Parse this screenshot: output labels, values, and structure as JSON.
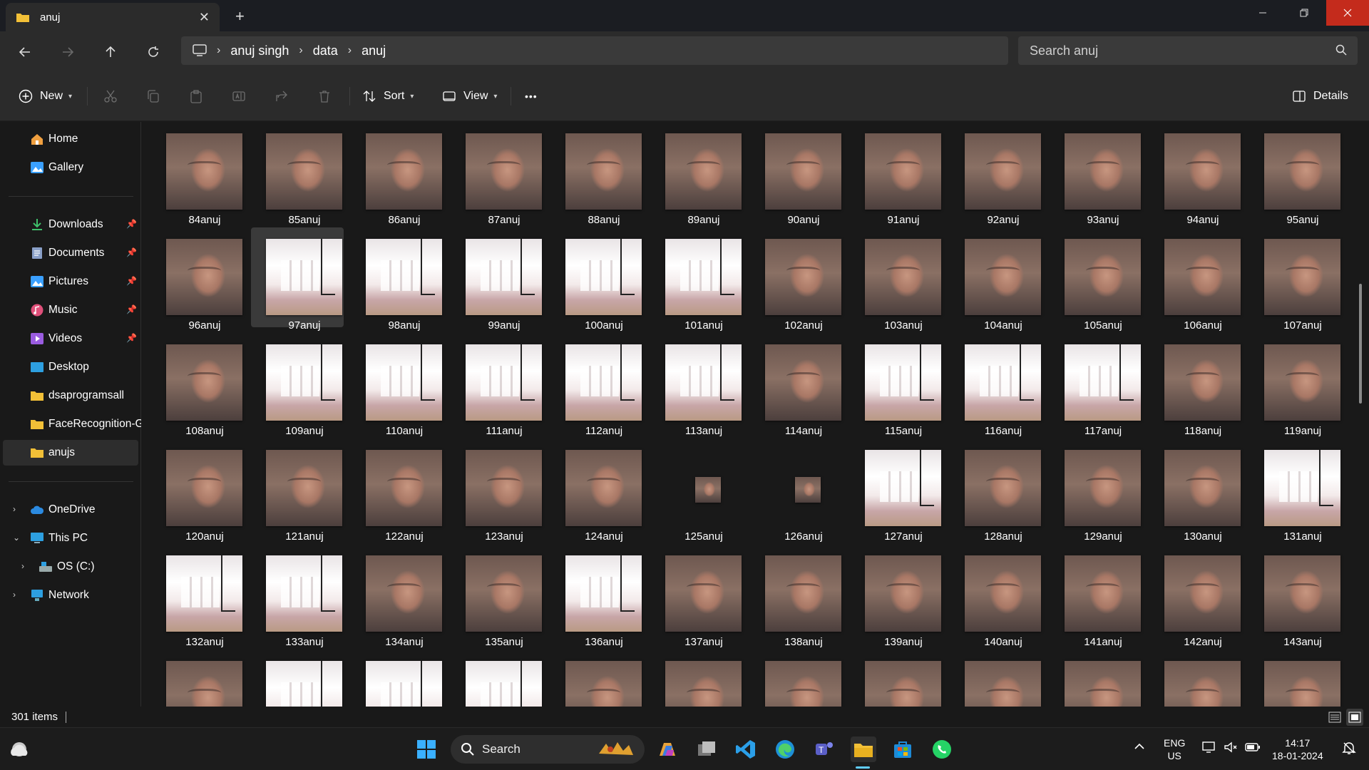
{
  "window": {
    "tab_title": "anuj",
    "close_tab_glyph": "✕",
    "new_tab_glyph": "+"
  },
  "address": {
    "crumbs": [
      "anuj singh",
      "data",
      "anuj"
    ],
    "search_placeholder": "Search anuj"
  },
  "toolbar": {
    "new_label": "New",
    "sort_label": "Sort",
    "view_label": "View",
    "more_label": "•••",
    "details_label": "Details"
  },
  "sidebar": {
    "items": [
      {
        "label": "Home",
        "icon": "home-icon",
        "color": "#f0a040"
      },
      {
        "label": "Gallery",
        "icon": "gallery-icon",
        "color": "#3aa0ff"
      },
      {
        "label": "Downloads",
        "icon": "download-icon",
        "color": "#3fc06a",
        "pinned": true
      },
      {
        "label": "Documents",
        "icon": "document-icon",
        "color": "#8aa0c8",
        "pinned": true
      },
      {
        "label": "Pictures",
        "icon": "picture-icon",
        "color": "#3aa0ff",
        "pinned": true
      },
      {
        "label": "Music",
        "icon": "music-icon",
        "color": "#e0507a",
        "pinned": true
      },
      {
        "label": "Videos",
        "icon": "video-icon",
        "color": "#9a5ce0",
        "pinned": true
      },
      {
        "label": "Desktop",
        "icon": "desktop-icon",
        "color": "#2d9fe0"
      },
      {
        "label": "dsaprogramsall",
        "icon": "folder-icon",
        "color": "#f2c037"
      },
      {
        "label": "FaceRecognition-GUI",
        "icon": "folder-icon",
        "color": "#f2c037"
      },
      {
        "label": "anujs",
        "icon": "folder-icon",
        "color": "#f2c037"
      }
    ],
    "tree": [
      {
        "label": "OneDrive",
        "icon": "cloud-icon"
      },
      {
        "label": "This PC",
        "icon": "pc-icon"
      },
      {
        "label": "OS (C:)",
        "icon": "drive-icon"
      },
      {
        "label": "Network",
        "icon": "network-icon"
      }
    ]
  },
  "files": {
    "rows": [
      [
        "84anuj",
        "85anuj",
        "86anuj",
        "87anuj",
        "88anuj",
        "89anuj",
        "90anuj",
        "91anuj",
        "92anuj",
        "93anuj",
        "94anuj",
        "95anuj"
      ],
      [
        "96anuj",
        "97anuj",
        "98anuj",
        "99anuj",
        "100anuj",
        "101anuj",
        "102anuj",
        "103anuj",
        "104anuj",
        "105anuj",
        "106anuj",
        "107anuj"
      ],
      [
        "108anuj",
        "109anuj",
        "110anuj",
        "111anuj",
        "112anuj",
        "113anuj",
        "114anuj",
        "115anuj",
        "116anuj",
        "117anuj",
        "118anuj",
        "119anuj"
      ],
      [
        "120anuj",
        "121anuj",
        "122anuj",
        "123anuj",
        "124anuj",
        "125anuj",
        "126anuj",
        "127anuj",
        "128anuj",
        "129anuj",
        "130anuj",
        "131anuj"
      ],
      [
        "132anuj",
        "133anuj",
        "134anuj",
        "135anuj",
        "136anuj",
        "137anuj",
        "138anuj",
        "139anuj",
        "140anuj",
        "141anuj",
        "142anuj",
        "143anuj"
      ],
      [
        "",
        "",
        "",
        "",
        "",
        "",
        "",
        "",
        "",
        "",
        "",
        ""
      ]
    ],
    "kinds": [
      [
        "face",
        "face",
        "face",
        "face",
        "face",
        "face",
        "face",
        "face",
        "face",
        "face",
        "face",
        "face"
      ],
      [
        "face",
        "room",
        "room",
        "room",
        "room",
        "room",
        "face",
        "face",
        "face",
        "face",
        "face",
        "face"
      ],
      [
        "face",
        "room",
        "room",
        "room",
        "room",
        "room",
        "face",
        "room",
        "room",
        "room",
        "face",
        "face"
      ],
      [
        "face",
        "face",
        "face",
        "face",
        "face",
        "tiny",
        "tiny",
        "room",
        "face",
        "face",
        "face",
        "room"
      ],
      [
        "room",
        "room",
        "face",
        "face",
        "room",
        "face",
        "face",
        "face",
        "face",
        "face",
        "face",
        "face"
      ],
      [
        "face",
        "room",
        "room",
        "room",
        "face",
        "face",
        "face",
        "face",
        "face",
        "face",
        "face",
        "face"
      ]
    ],
    "selected": "97anuj"
  },
  "status": {
    "item_count": "301 items"
  },
  "taskbar": {
    "search_label": "Search",
    "lang_line1": "ENG",
    "lang_line2": "US",
    "time": "14:17",
    "date": "18-01-2024"
  }
}
